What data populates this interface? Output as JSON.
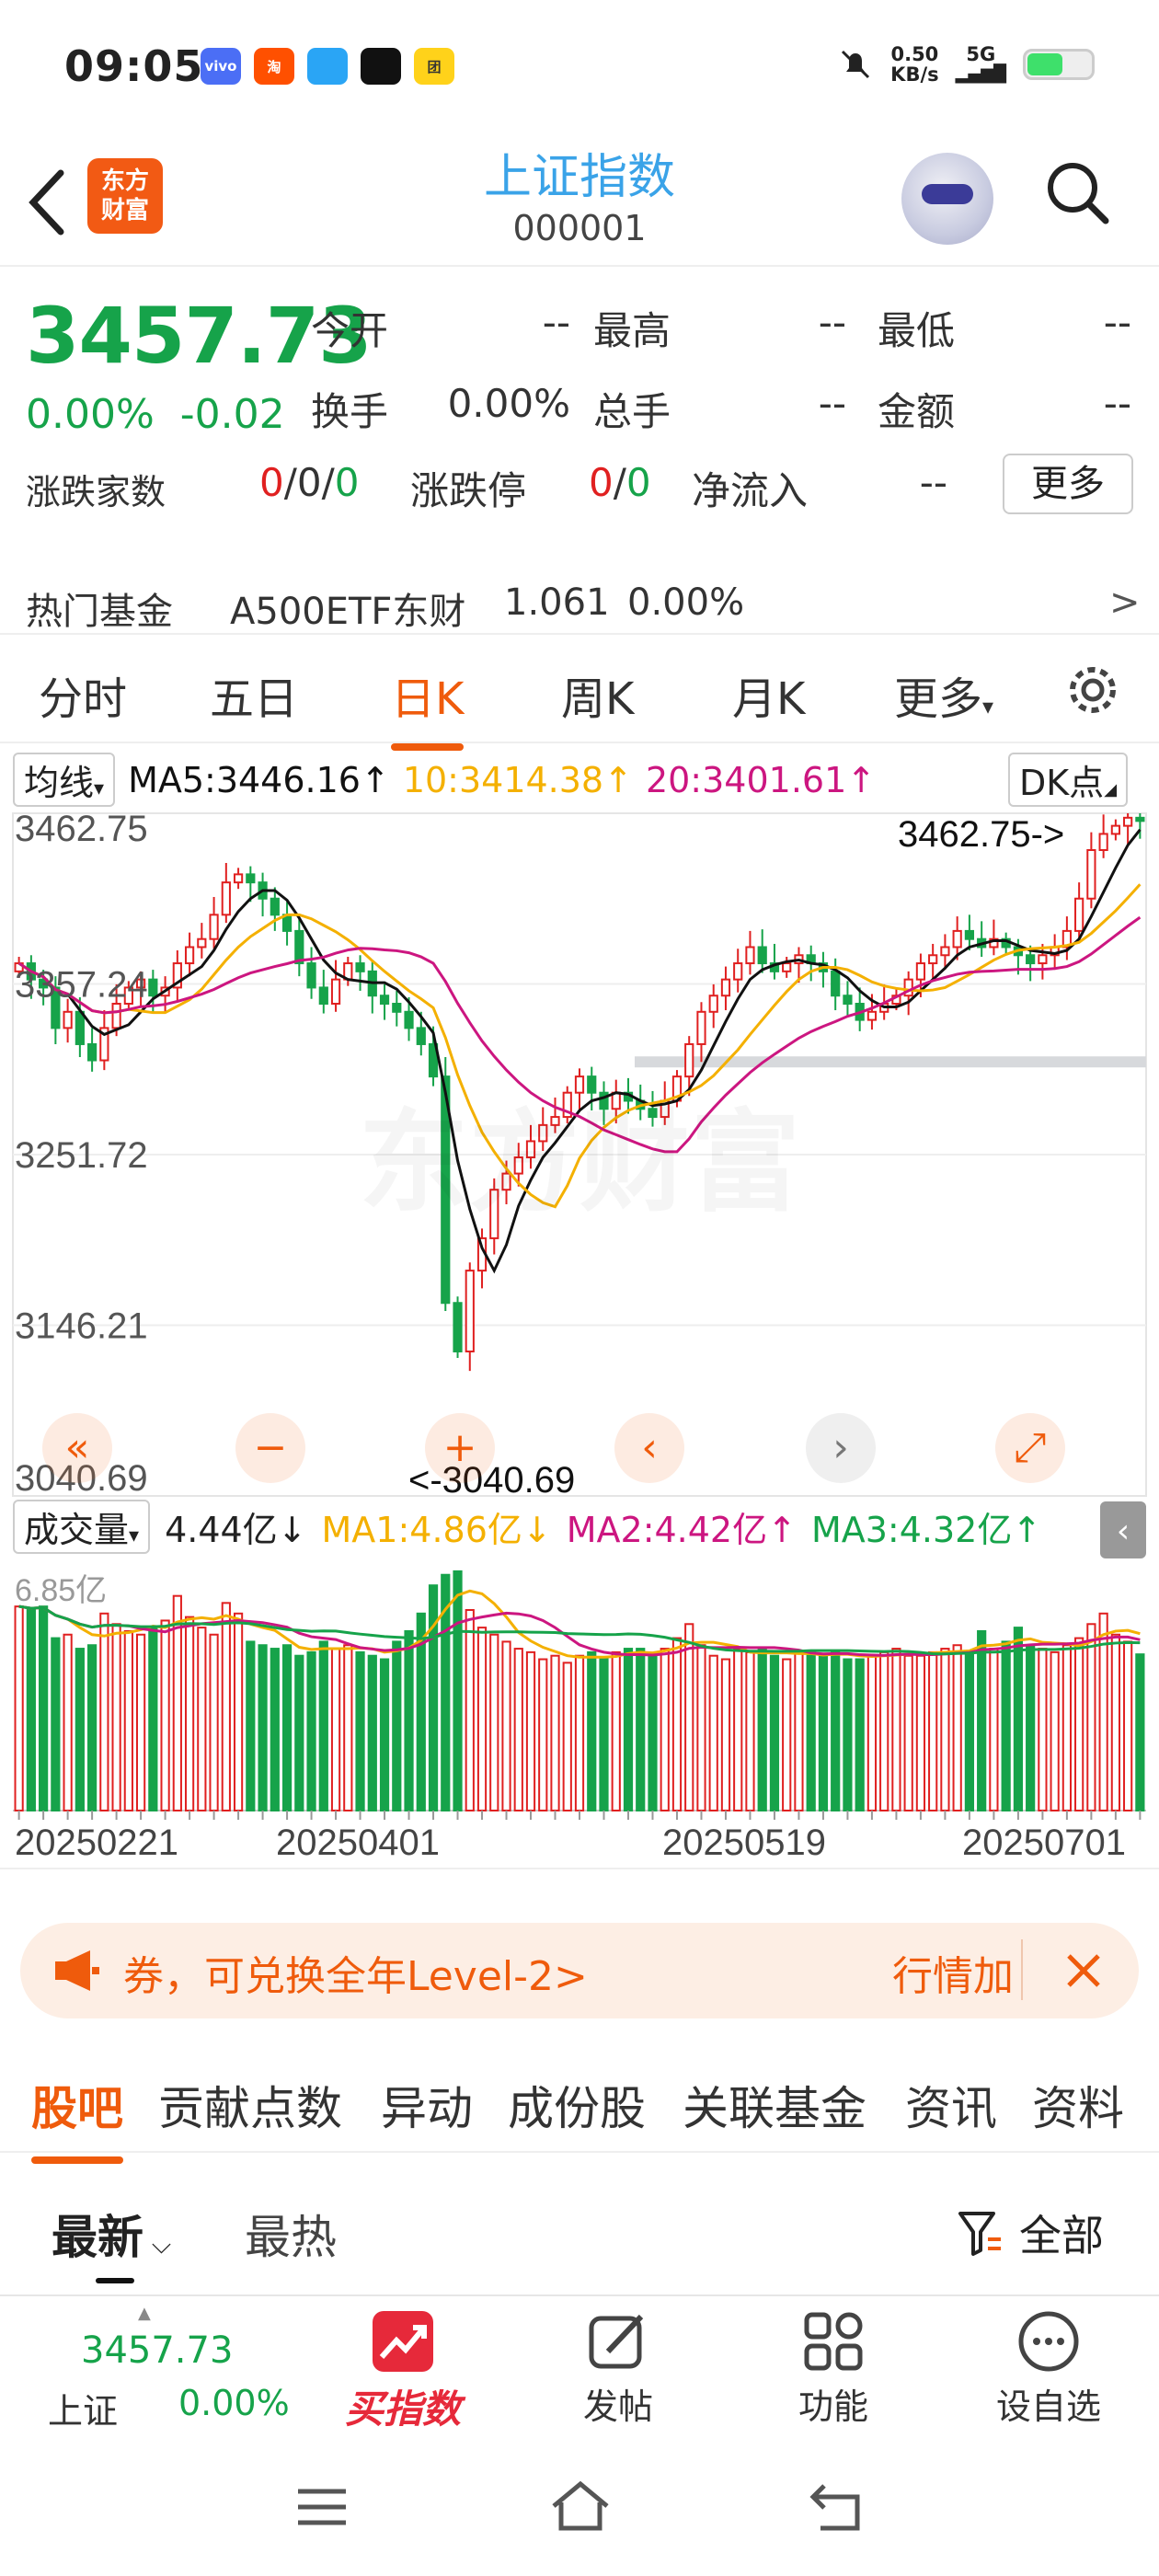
{
  "status_bar": {
    "time": "09:05",
    "net_speed": "0.50",
    "net_unit": "KB/s",
    "signal": "5G",
    "apps": [
      "vivo",
      "淘",
      "",
      "",
      "团"
    ]
  },
  "nav": {
    "logo_line1": "东方",
    "logo_line2": "财富",
    "title": "上证指数",
    "code": "000001"
  },
  "quote": {
    "price": "3457.73",
    "change_pct": "0.00%",
    "change": "-0.02",
    "open_label": "今开",
    "open": "--",
    "high_label": "最高",
    "high": "--",
    "low_label": "最低",
    "low": "--",
    "turnover_label": "换手",
    "turnover": "0.00%",
    "volume_label": "总手",
    "volume": "--",
    "amount_label": "金额",
    "amount": "--",
    "breadth_label": "涨跌家数",
    "breadth_up": "0",
    "breadth_flat": "0",
    "breadth_down": "0",
    "limit_label": "涨跌停",
    "limit_up": "0",
    "limit_down": "0",
    "inflow_label": "净流入",
    "inflow": "--",
    "more_button": "更多"
  },
  "hot_fund": {
    "label": "热门基金",
    "name": "A500ETF东财",
    "price": "1.061",
    "pct": "0.00%",
    "arrow": ">"
  },
  "period_tabs": [
    "分时",
    "五日",
    "日K",
    "周K",
    "月K",
    "更多"
  ],
  "active_period": "日K",
  "ma_bar": {
    "selector": "均线",
    "ma5": "MA5:3446.16",
    "ma10": "10:3414.38",
    "ma20": "20:3401.61",
    "dk_button": "DK点"
  },
  "price_axis": {
    "labels": [
      "3462.75",
      "3357.24",
      "3251.72",
      "3146.21",
      "3040.69"
    ],
    "high_callout": "3462.75->",
    "low_callout": "<-3040.69"
  },
  "volume_bar": {
    "selector": "成交量",
    "vol": "4.44亿",
    "ma1": "MA1:4.86亿",
    "ma2": "MA2:4.42亿",
    "ma3": "MA3:4.32亿",
    "axis_max": "6.85亿"
  },
  "date_axis": [
    "20250221",
    "20250401",
    "20250519",
    "20250701"
  ],
  "watermark": "东方财富",
  "colors": {
    "up": "#e02020",
    "down": "#16a34a",
    "accent": "#ef5b0c",
    "ma5": "#111111",
    "ma10": "#f4b000",
    "ma20": "#cc1680"
  },
  "chart_data": {
    "type": "candlestick",
    "title": "",
    "ylim": [
      3040.69,
      3462.75
    ],
    "y_ticks": [
      3462.75,
      3357.24,
      3251.72,
      3146.21,
      3040.69
    ],
    "x_ticks": [
      "20250221",
      "20250401",
      "20250519",
      "20250701"
    ],
    "closes": [
      3370,
      3360,
      3355,
      3330,
      3340,
      3320,
      3310,
      3330,
      3345,
      3355,
      3360,
      3350,
      3355,
      3370,
      3380,
      3385,
      3400,
      3420,
      3425,
      3420,
      3410,
      3400,
      3390,
      3370,
      3355,
      3345,
      3360,
      3370,
      3365,
      3350,
      3345,
      3340,
      3330,
      3320,
      3300,
      3160,
      3130,
      3180,
      3200,
      3230,
      3240,
      3250,
      3260,
      3270,
      3275,
      3290,
      3300,
      3290,
      3280,
      3290,
      3285,
      3280,
      3275,
      3285,
      3300,
      3320,
      3340,
      3350,
      3360,
      3370,
      3380,
      3370,
      3365,
      3370,
      3375,
      3370,
      3365,
      3350,
      3345,
      3335,
      3340,
      3345,
      3350,
      3360,
      3370,
      3375,
      3380,
      3390,
      3385,
      3380,
      3385,
      3380,
      3375,
      3370,
      3375,
      3380,
      3390,
      3410,
      3440,
      3450,
      3455,
      3460,
      3458
    ],
    "volumes": [
      5.8,
      5.7,
      5.8,
      4.9,
      5.0,
      4.6,
      4.7,
      5.6,
      5.3,
      5.1,
      5.0,
      5.2,
      5.4,
      6.1,
      5.5,
      5.2,
      5.0,
      5.9,
      5.6,
      4.8,
      4.7,
      4.6,
      4.7,
      4.4,
      4.5,
      4.8,
      4.6,
      4.7,
      4.5,
      4.4,
      4.3,
      4.8,
      5.1,
      5.6,
      6.4,
      6.7,
      6.8,
      5.7,
      5.2,
      5.0,
      4.8,
      4.6,
      4.5,
      4.3,
      4.4,
      4.2,
      4.4,
      4.5,
      4.3,
      4.5,
      4.6,
      4.6,
      4.4,
      4.6,
      4.9,
      5.3,
      4.7,
      4.4,
      4.3,
      4.6,
      4.5,
      4.6,
      4.4,
      4.3,
      4.5,
      4.5,
      4.4,
      4.5,
      4.3,
      4.3,
      4.4,
      4.5,
      4.6,
      4.4,
      4.4,
      4.5,
      4.6,
      4.7,
      4.5,
      5.1,
      4.6,
      4.8,
      5.2,
      4.7,
      4.6,
      4.5,
      4.7,
      4.9,
      5.3,
      5.6,
      5.0,
      4.8,
      4.44
    ],
    "vol_max": 6.85,
    "vol_unit": "亿"
  },
  "promo": {
    "text": "券，可兑换全年Level-2>",
    "right_text": "行情加"
  },
  "sub_tabs": [
    "股吧",
    "贡献点数",
    "异动",
    "成份股",
    "关联基金",
    "资讯",
    "资料"
  ],
  "feed_filter": {
    "latest": "最新",
    "hot": "最热",
    "all": "全部"
  },
  "bottom_bar": {
    "index_price": "3457.73",
    "index_name": "上证",
    "index_pct": "0.00%",
    "buy": "买指数",
    "post": "发帖",
    "func": "功能",
    "watch": "设自选"
  }
}
